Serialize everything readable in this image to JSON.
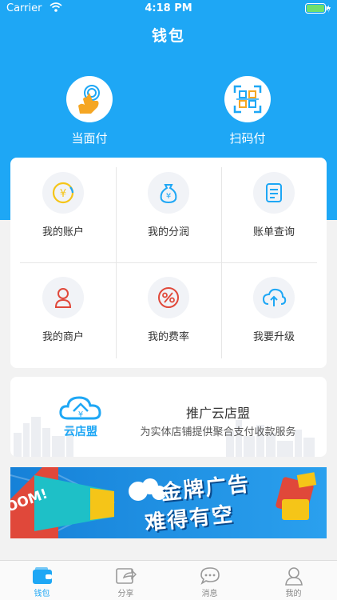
{
  "status_bar": {
    "carrier": "Carrier",
    "time": "4:18 PM"
  },
  "nav": {
    "title": "钱包"
  },
  "quick_actions": [
    {
      "label": "当面付",
      "icon": "tap-hand-icon"
    },
    {
      "label": "扫码付",
      "icon": "qr-scan-icon"
    }
  ],
  "grid": {
    "items": [
      {
        "label": "我的账户",
        "icon": "yuan-coin-icon"
      },
      {
        "label": "我的分润",
        "icon": "money-bag-icon"
      },
      {
        "label": "账单查询",
        "icon": "bill-document-icon"
      },
      {
        "label": "我的商户",
        "icon": "merchant-person-icon"
      },
      {
        "label": "我的费率",
        "icon": "rate-percent-icon"
      },
      {
        "label": "我要升级",
        "icon": "cloud-upload-icon"
      }
    ]
  },
  "promo": {
    "logo_text": "云店盟",
    "title": "推广云店盟",
    "subtitle": "为实体店铺提供聚合支付收款服务"
  },
  "ad_banner": {
    "line1": "金牌广告",
    "line2": "难得有空",
    "burst_text": "OOM!"
  },
  "tabbar": {
    "items": [
      {
        "label": "钱包",
        "icon": "wallet-icon"
      },
      {
        "label": "分享",
        "icon": "share-icon"
      },
      {
        "label": "消息",
        "icon": "message-icon"
      },
      {
        "label": "我的",
        "icon": "profile-icon"
      }
    ]
  },
  "colors": {
    "primary": "#1ea7f5",
    "accent_yellow": "#f5c518",
    "accent_red": "#e0483a"
  }
}
